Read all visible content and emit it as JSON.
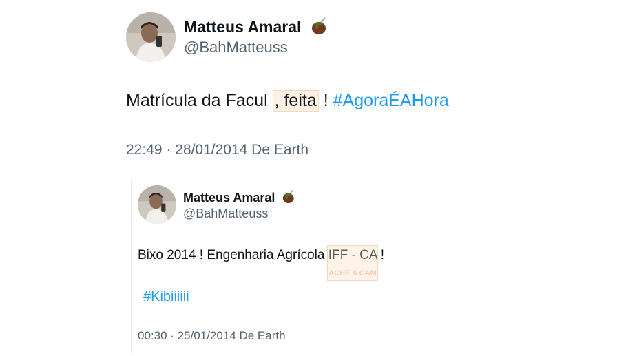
{
  "tweet": {
    "author": {
      "name": "Matteus Amaral",
      "handle": "@BahMatteuss",
      "badge_icon": "mate-gourd-icon"
    },
    "text_part1": "Matrícula da Facul",
    "text_part2": ", feita",
    "text_part3": "! ",
    "hashtag": "#AgoraÉAHora",
    "timestamp": "22:49 · 28/01/2014 De Earth"
  },
  "quoted": {
    "author": {
      "name": "Matteus Amaral",
      "handle": "@BahMatteuss",
      "badge_icon": "mate-gourd-icon"
    },
    "text": "Bixo 2014 ! Engenharia Agrícola IFF - CA !",
    "hashtag": "#Kibiiiiii",
    "timestamp": "00:30 · 25/01/2014 De Earth",
    "watermark": "ACHE A CAM"
  },
  "colors": {
    "hashtag": "#1d9bf0",
    "secondary_text": "#536471",
    "primary_text": "#0f1419"
  }
}
